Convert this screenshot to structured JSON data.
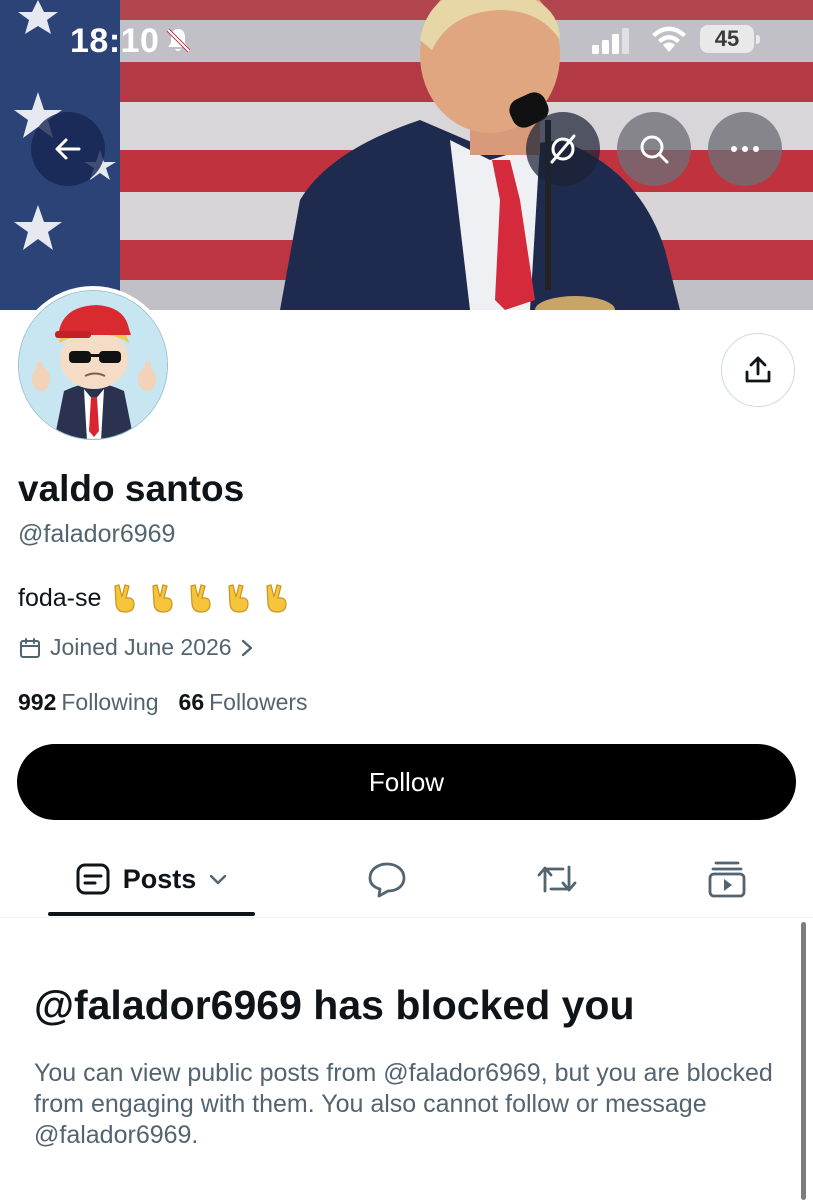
{
  "status_bar": {
    "time": "18:10",
    "battery": "45",
    "icons": [
      "bell-slash-icon",
      "cellular-signal-icon",
      "wifi-icon",
      "battery-icon"
    ]
  },
  "nav": {
    "icons": [
      "back-arrow-icon",
      "grok-icon",
      "search-icon",
      "more-icon"
    ]
  },
  "profile": {
    "display_name": "valdo santos",
    "handle": "@falador6969",
    "bio_text": "foda-se",
    "bio_emoji": [
      "✌️",
      "✌️",
      "✌️",
      "✌️",
      "✌️"
    ],
    "joined": "Joined June 2026",
    "following_count": "992",
    "following_label": "Following",
    "followers_count": "66",
    "followers_label": "Followers"
  },
  "actions": {
    "follow_label": "Follow",
    "share_icon": "share-icon"
  },
  "tabs": {
    "posts_label": "Posts",
    "icons": [
      "posts-icon",
      "chevron-down-icon",
      "replies-icon",
      "reposts-icon",
      "media-icon"
    ]
  },
  "blocked": {
    "title": "@falador6969 has blocked you",
    "description": "You can view public posts from @falador6969, but you are blocked from engaging with them. You also cannot follow or message @falador6969."
  },
  "colors": {
    "text_primary": "#0f1419",
    "text_secondary": "#536471",
    "follow_button_bg": "#000000",
    "border": "#cfd9de"
  }
}
